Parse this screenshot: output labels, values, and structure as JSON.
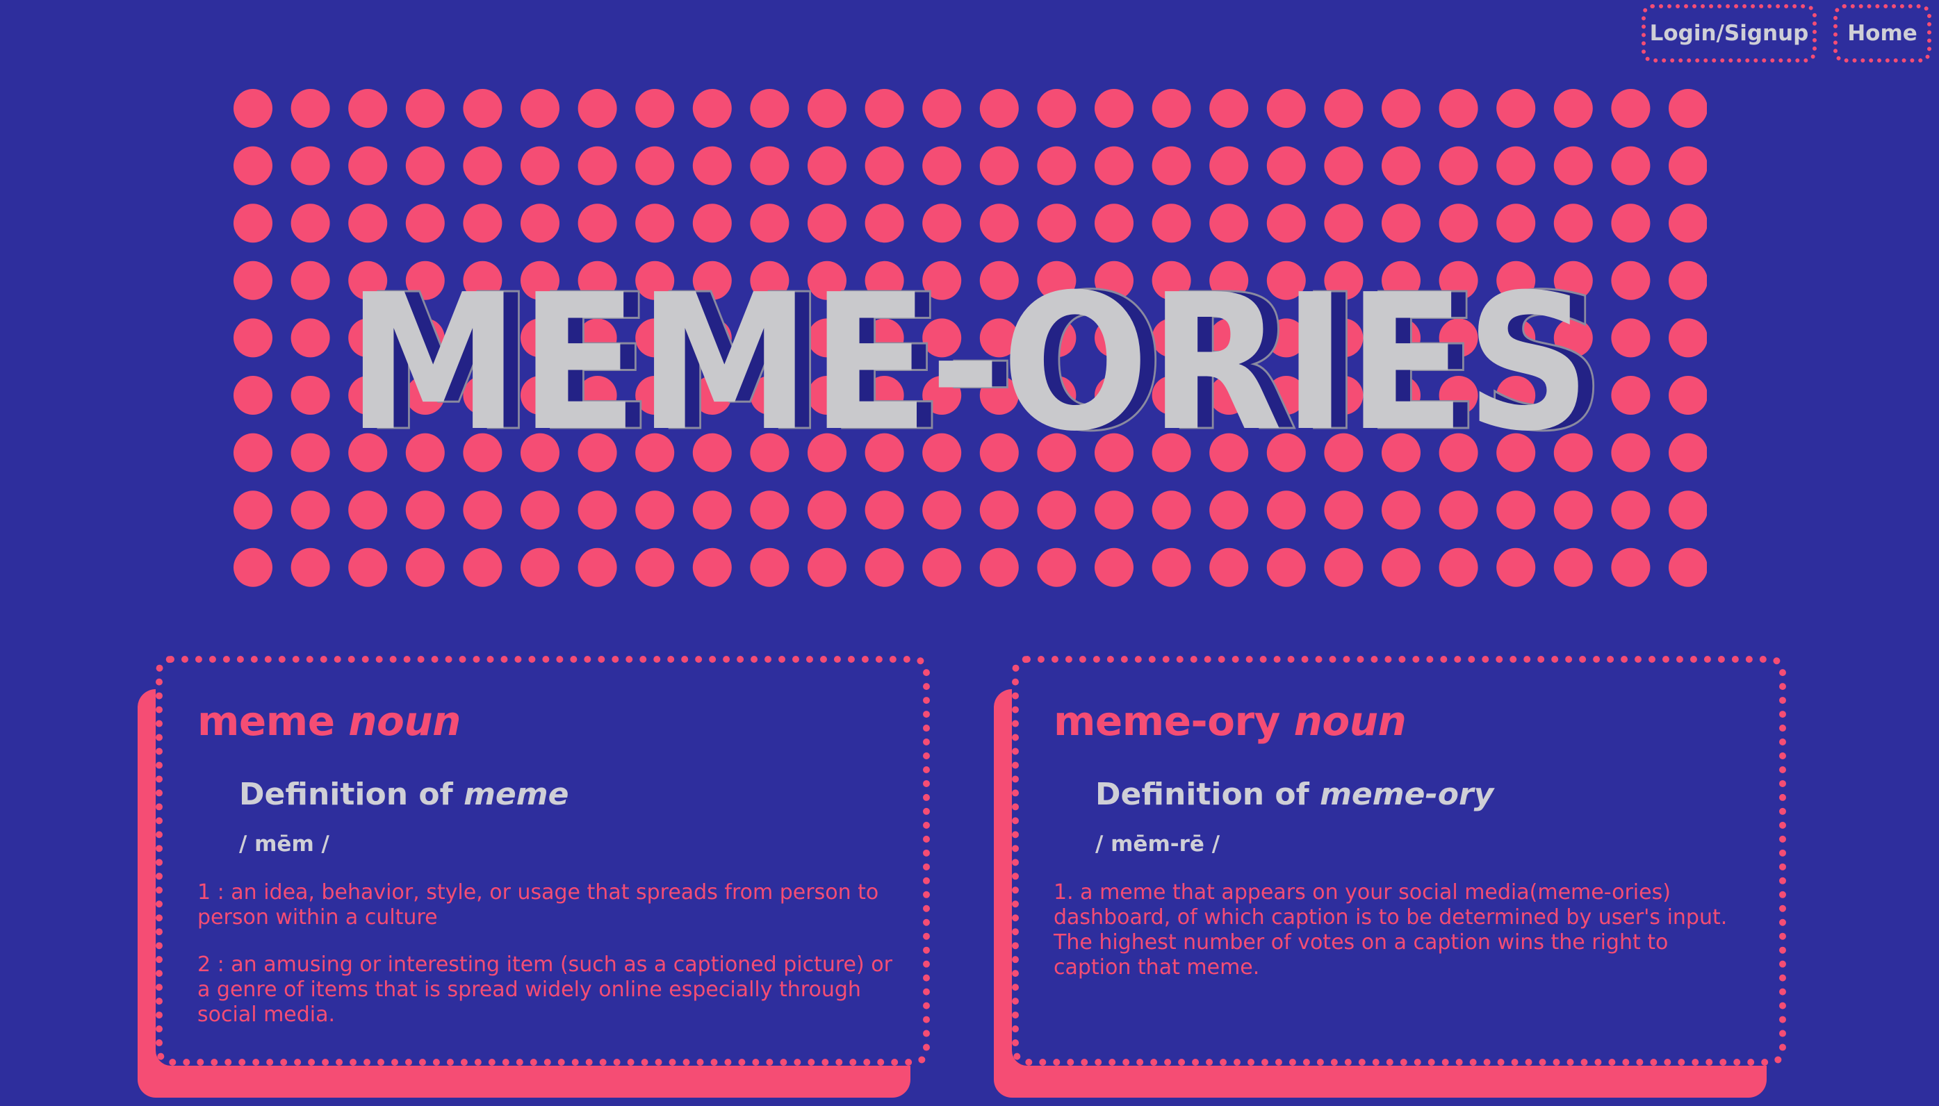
{
  "nav": {
    "login_label": "Login/Signup",
    "home_label": "Home"
  },
  "hero": {
    "title": "MEME-ORIES",
    "colors": {
      "dots": "#f54d74",
      "letters": "#c9c9cc",
      "letter_shadow": "#232286",
      "background": "#2e2e9d"
    }
  },
  "cards": [
    {
      "word": "meme",
      "pos": "noun",
      "definition_label": "Definition of",
      "definition_word": "meme",
      "pronunciation": "/ mēm /",
      "definitions": [
        "1 : an idea, behavior, style, or usage that spreads from person to person within a culture",
        "2 : an amusing or interesting item (such as a captioned picture) or a genre of items that is spread widely online especially through social media."
      ]
    },
    {
      "word": "meme-ory",
      "pos": "noun",
      "definition_label": "Definition of",
      "definition_word": "meme-ory",
      "pronunciation": "/ mēm-rē /",
      "definitions": [
        "1. a meme that appears on your social media(meme-ories) dashboard, of which caption is to be determined by user's input. The highest number of votes on a caption wins the right to caption that meme."
      ]
    }
  ],
  "theme": {
    "background": "#2e2e9d",
    "accent": "#f54d74",
    "text_light": "#cfcfd6"
  }
}
